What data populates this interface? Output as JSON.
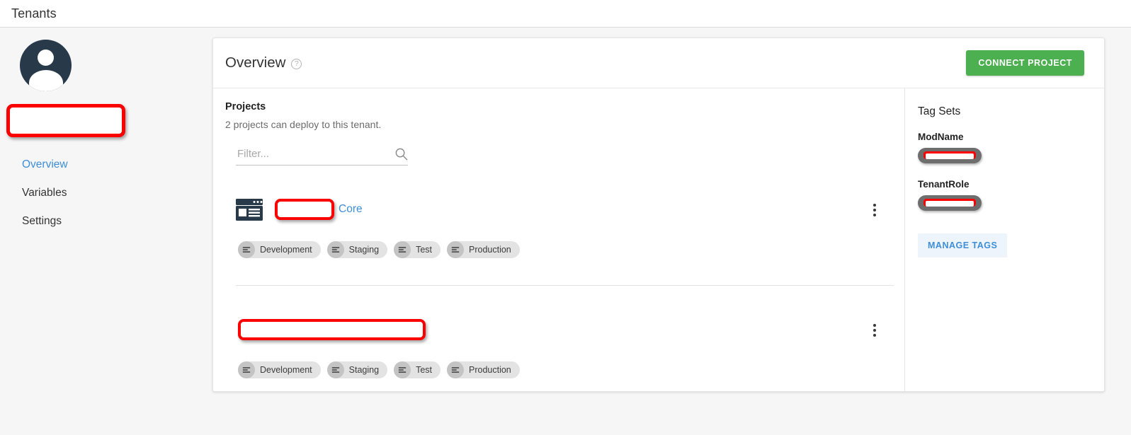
{
  "topbar": {
    "title": "Tenants"
  },
  "sidebar": {
    "avatar_icon": "user-avatar-icon",
    "tenant_name_redacted": "",
    "items": [
      {
        "label": "Overview",
        "active": true
      },
      {
        "label": "Variables",
        "active": false
      },
      {
        "label": "Settings",
        "active": false
      }
    ]
  },
  "card": {
    "title": "Overview",
    "help_icon": "help-circle-icon",
    "help_glyph": "?",
    "connect_button": "CONNECT PROJECT"
  },
  "projects": {
    "section_title": "Projects",
    "section_subtitle": "2 projects can deploy to this tenant.",
    "filter": {
      "placeholder": "Filter...",
      "value": "",
      "icon": "search-icon"
    },
    "items": [
      {
        "icon": "project-window-icon",
        "name_redacted": "",
        "name_suffix": "Core",
        "menu_icon": "kebab-menu-icon",
        "environments": [
          {
            "label": "Development",
            "icon": "environment-icon"
          },
          {
            "label": "Staging",
            "icon": "environment-icon"
          },
          {
            "label": "Test",
            "icon": "environment-icon"
          },
          {
            "label": "Production",
            "icon": "environment-icon"
          }
        ]
      },
      {
        "icon": "",
        "name_redacted": "",
        "name_suffix": "",
        "menu_icon": "kebab-menu-icon",
        "environments": [
          {
            "label": "Development",
            "icon": "environment-icon"
          },
          {
            "label": "Staging",
            "icon": "environment-icon"
          },
          {
            "label": "Test",
            "icon": "environment-icon"
          },
          {
            "label": "Production",
            "icon": "environment-icon"
          }
        ]
      }
    ]
  },
  "tagsets": {
    "title": "Tag Sets",
    "groups": [
      {
        "label": "ModName",
        "tag_redacted": ""
      },
      {
        "label": "TenantRole",
        "tag_redacted": ""
      }
    ],
    "manage_button": "MANAGE TAGS"
  },
  "colors": {
    "accent_green": "#4caf50",
    "link_blue": "#3e8ed8",
    "redaction_red": "#fc0000",
    "avatar_navy": "#28394a",
    "page_background": "#f6f6f6"
  }
}
